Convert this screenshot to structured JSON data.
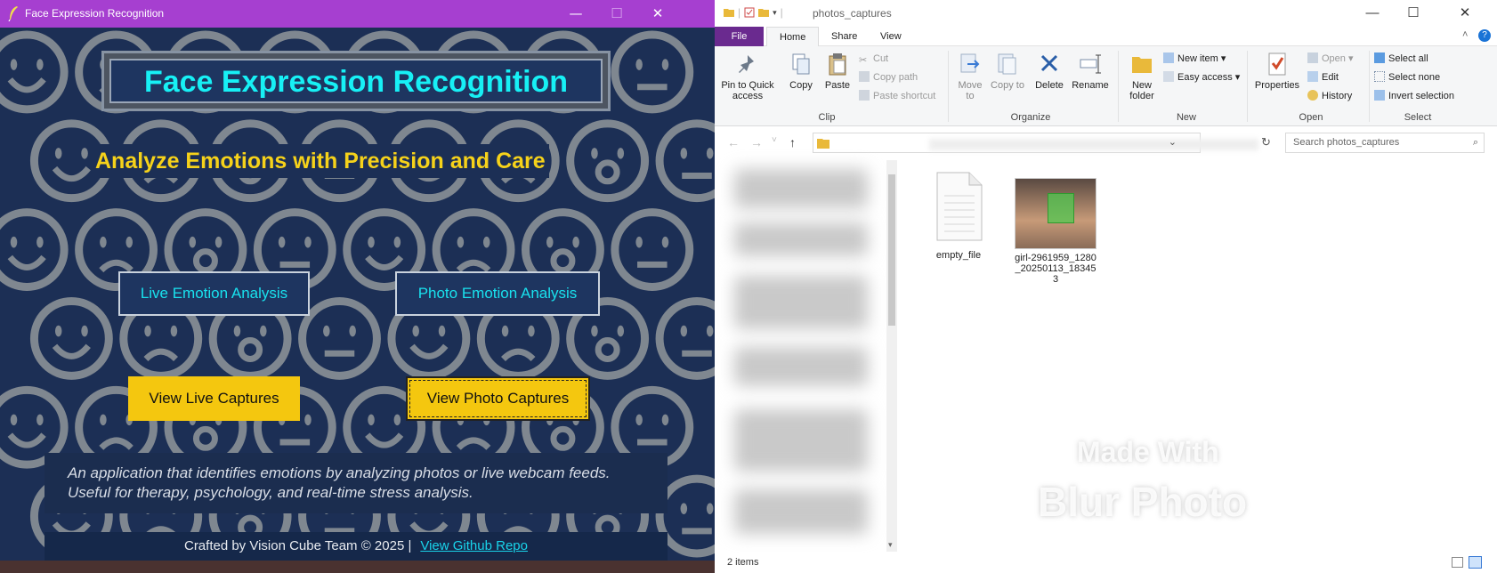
{
  "app": {
    "title": "Face Expression Recognition",
    "banner_title": "Face Expression Recognition",
    "subtitle": "Analyze Emotions with Precision and Care",
    "buttons": {
      "live_analysis": "Live Emotion Analysis",
      "photo_analysis": "Photo Emotion Analysis",
      "live_captures": "View Live Captures",
      "photo_captures": "View Photo Captures"
    },
    "description": "An application that identifies emotions by analyzing photos or live webcam feeds. Useful for therapy, psychology, and real-time stress analysis.",
    "footer_credit": "Crafted by Vision Cube Team © 2025 |",
    "footer_link": "View Github Repo",
    "window_controls": {
      "minimize": "—",
      "maximize": "☐",
      "close": "✕"
    }
  },
  "explorer": {
    "title": "photos_captures",
    "tabs": [
      "File",
      "Home",
      "Share",
      "View"
    ],
    "active_tab": "Home",
    "clipboard": {
      "pin": "Pin to Quick access",
      "copy": "Copy",
      "paste": "Paste",
      "cut": "Cut",
      "copy_path": "Copy path",
      "paste_shortcut": "Paste shortcut",
      "group_label": "Clip"
    },
    "organize": {
      "move_to": "Move to",
      "copy_to": "Copy to",
      "delete": "Delete",
      "rename": "Rename",
      "group_label": "Organize"
    },
    "new_group": {
      "new_folder": "New folder",
      "new_item": "New item",
      "easy_access": "Easy access",
      "group_label": "New"
    },
    "open_group": {
      "properties": "Properties",
      "open": "Open",
      "edit": "Edit",
      "history": "History",
      "group_label": "Open"
    },
    "select_group": {
      "select_all": "Select all",
      "select_none": "Select none",
      "invert": "Invert selection",
      "group_label": "Select"
    },
    "search_placeholder": "Search photos_captures",
    "files": [
      {
        "name": "empty_file",
        "kind": "document"
      },
      {
        "name": "girl-2961959_1280_20250113_183453",
        "kind": "image"
      }
    ],
    "status": "2 items",
    "watermark_line1": "Made With",
    "watermark_line2": "Blur Photo"
  },
  "colors": {
    "app_titlebar": "#a63fd0",
    "app_bg": "#1c2f55",
    "accent_cyan": "#17f0f5",
    "accent_yellow": "#f4c70f",
    "file_tab": "#6a2a8f"
  }
}
